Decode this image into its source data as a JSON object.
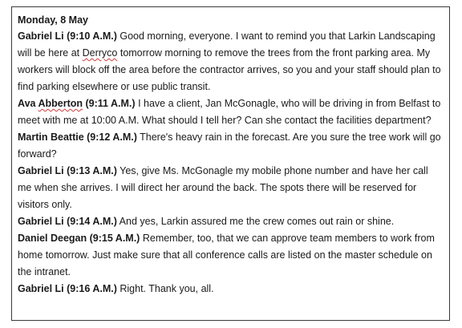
{
  "chat": {
    "date": "Monday, 8 May",
    "messages": [
      {
        "speaker": "Gabriel Li (9:10 A.M.)",
        "text": "Good morning, everyone. I want to remind you that Larkin Landscaping will be here at Derryco tomorrow morning to remove the trees from the front parking area. My workers will block off the area before the contractor arrives, so you and your staff should plan to find parking elsewhere or use public transit."
      },
      {
        "speaker": "Ava Abberton (9:11 A.M.)",
        "text": "I have a client, Jan McGonagle, who will be driving in from Belfast to meet with me at 10:00 A.M. What should I tell her? Can she contact the facilities department?"
      },
      {
        "speaker": "Martin Beattie (9:12 A.M.)",
        "text": "There's heavy rain in the forecast. Are you sure the tree work will go forward?"
      },
      {
        "speaker": "Gabriel Li (9:13 A.M.)",
        "text": "Yes, give Ms. McGonagle my mobile phone number and have her call me when she arrives. I will direct her around the back. The spots there will be reserved for visitors only."
      },
      {
        "speaker": "Gabriel Li (9:14 A.M.)",
        "text": "And yes, Larkin assured me the crew comes out rain or shine."
      },
      {
        "speaker": "Daniel Deegan (9:15 A.M.)",
        "text": "Remember, too, that we can approve team members to work from home tomorrow. Just make sure that all conference calls are listed on the master schedule on the intranet."
      },
      {
        "speaker": "Gabriel Li (9:16 A.M.)",
        "text": "Right. Thank you, all."
      }
    ]
  }
}
